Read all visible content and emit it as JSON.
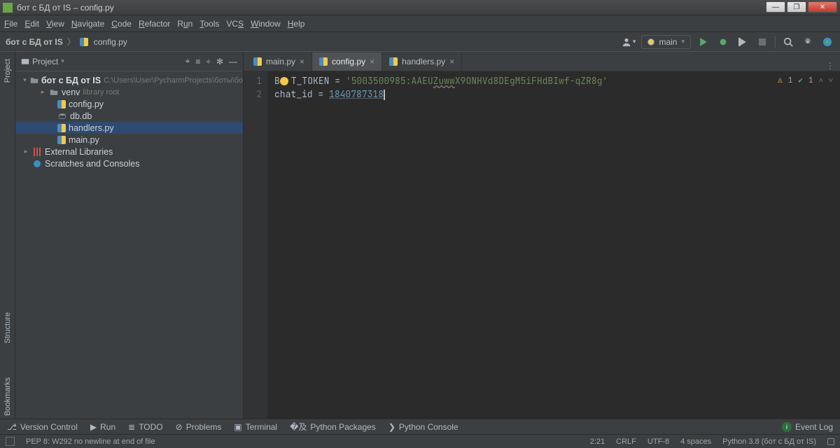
{
  "window": {
    "title": "бот с БД от IS – config.py"
  },
  "winbtns": {
    "min": "—",
    "max": "❐",
    "close": "✕"
  },
  "menu": {
    "file": "File",
    "edit": "Edit",
    "view": "View",
    "navigate": "Navigate",
    "code": "Code",
    "refactor": "Refactor",
    "run": "Run",
    "tools": "Tools",
    "vcs": "VCS",
    "window": "Window",
    "help": "Help"
  },
  "breadcrumb": {
    "root": "бот с БД от IS",
    "file": "config.py"
  },
  "runconfig": {
    "name": "main"
  },
  "project": {
    "label": "Project",
    "root": {
      "name": "бот с БД от IS",
      "path": "C:\\Users\\User\\PycharmProjects\\боты\\бо"
    },
    "venv": {
      "name": "venv",
      "note": "library root"
    },
    "files": {
      "config": "config.py",
      "db": "db.db",
      "handlers": "handlers.py",
      "main": "main.py"
    },
    "ext": "External Libraries",
    "scratch": "Scratches and Consoles"
  },
  "tabs": {
    "main": "main.py",
    "config": "config.py",
    "handlers": "handlers.py"
  },
  "code": {
    "line1_pre": "B",
    "line1_var": "T_TOKEN",
    "line1_eq": " = ",
    "line1_str_a": "'5003500985:AAEU",
    "line1_str_u": "Zuww",
    "line1_str_b": "X9ONHVd8DEgM5iFHdBIwf-qZR8g'",
    "line2_var": "chat_id",
    "line2_eq": " = ",
    "line2_num": "1840787318",
    "ln1": "1",
    "ln2": "2"
  },
  "inspections": {
    "warn": "1",
    "ok": "1"
  },
  "bottom": {
    "vc": "Version Control",
    "run": "Run",
    "todo": "TODO",
    "problems": "Problems",
    "terminal": "Terminal",
    "pypkg": "Python Packages",
    "pycon": "Python Console",
    "eventlog": "Event Log"
  },
  "status": {
    "pep": "PEP 8: W292 no newline at end of file",
    "pos": "2:21",
    "crlf": "CRLF",
    "enc": "UTF-8",
    "indent": "4 spaces",
    "interpreter": "Python 3.8 (бот с БД от IS)"
  },
  "sidetabs": {
    "project": "Project",
    "structure": "Structure",
    "bookmarks": "Bookmarks"
  }
}
